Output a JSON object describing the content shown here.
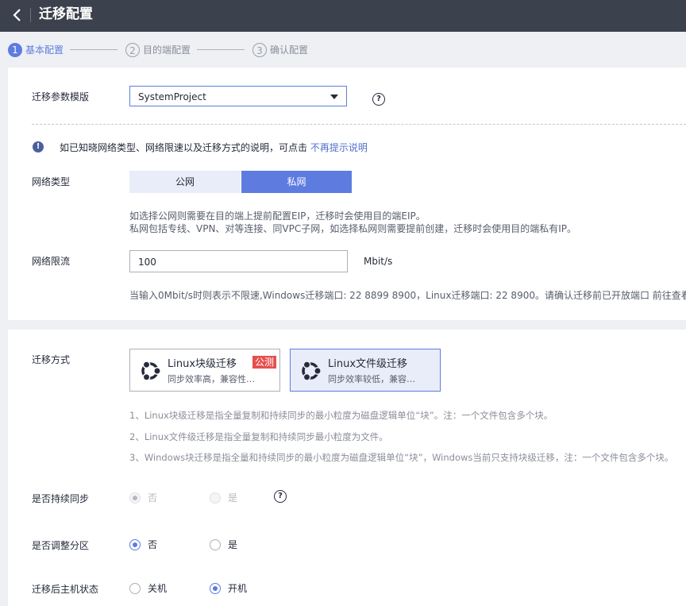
{
  "header": {
    "title": "迁移配置"
  },
  "steps": [
    {
      "num": "1",
      "label": "基本配置"
    },
    {
      "num": "2",
      "label": "目的端配置"
    },
    {
      "num": "3",
      "label": "确认配置"
    }
  ],
  "template": {
    "label": "迁移参数模版",
    "value": "SystemProject"
  },
  "notice": {
    "text": "如已知晓网络类型、网络限速以及迁移方式的说明，可点击",
    "link": "不再提示说明"
  },
  "network": {
    "label": "网络类型",
    "options": [
      "公网",
      "私网"
    ],
    "selected": "私网",
    "hint1": "如选择公网则需要在目的端上提前配置EIP，迁移时会使用目的端EIP。",
    "hint2": "私网包括专线、VPN、对等连接、同VPC子网，如选择私网则需要提前创建，迁移时会使用目的端私有IP。"
  },
  "rate": {
    "label": "网络限流",
    "value": "100",
    "unit": "Mbit/s",
    "hint": "当输入0Mbit/s时则表示不限速,Windows迁移端口: 22 8899 8900，Linux迁移端口: 22 8900。请确认迁移前已开放端口 前往查看端口"
  },
  "migration": {
    "label": "迁移方式",
    "options": [
      {
        "title": "Linux块级迁移",
        "sub": "同步效率高，兼容性…",
        "badge": "公测"
      },
      {
        "title": "Linux文件级迁移",
        "sub": "同步效率较低，兼容…"
      }
    ],
    "notes": [
      "1、Linux块级迁移是指全量复制和持续同步的最小粒度为磁盘逻辑单位“块”。注：一个文件包含多个块。",
      "2、Linux文件级迁移是指全量复制和持续同步最小粒度为文件。",
      "3、Windows块迁移是指全量和持续同步的最小粒度为磁盘逻辑单位“块”，Windows当前只支持块级迁移，注：一个文件包含多个块。"
    ]
  },
  "continuous_sync": {
    "label": "是否持续同步",
    "options": [
      "否",
      "是"
    ],
    "selected": "否"
  },
  "resize_partition": {
    "label": "是否调整分区",
    "options": [
      "否",
      "是"
    ],
    "selected": "否"
  },
  "host_state": {
    "label": "迁移后主机状态",
    "options": [
      "关机",
      "开机"
    ],
    "selected": "开机"
  },
  "colors": {
    "primary": "#5e7ce0",
    "header_bg": "#3b424d",
    "badge": "#e5504d"
  }
}
